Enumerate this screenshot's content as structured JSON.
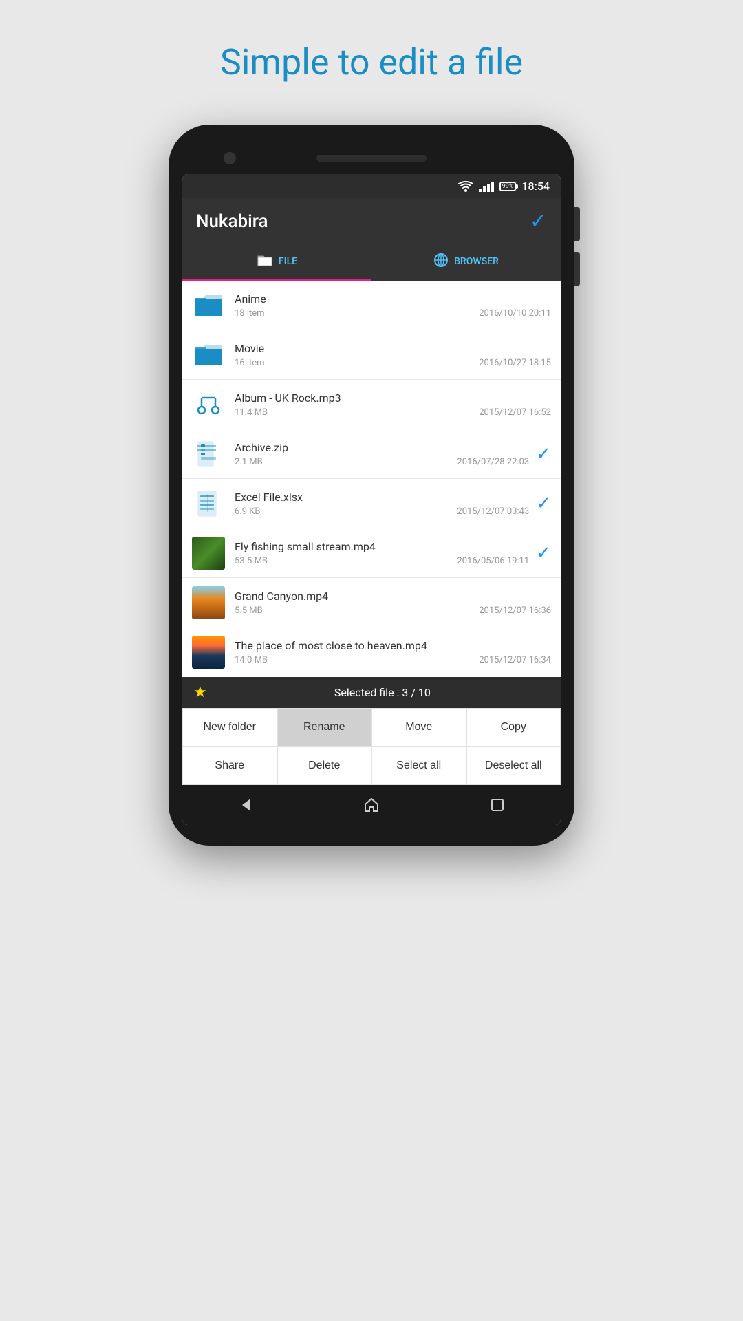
{
  "page": {
    "headline": "Simple to edit a file"
  },
  "statusBar": {
    "battery": "99%",
    "time": "18:54"
  },
  "appBar": {
    "title": "Nukabira"
  },
  "tabs": [
    {
      "id": "file",
      "label": "FILE",
      "active": true
    },
    {
      "id": "browser",
      "label": "BROWSER",
      "active": false
    }
  ],
  "files": [
    {
      "id": 1,
      "name": "Anime",
      "type": "folder",
      "count": "18 item",
      "date": "2016/10/10 20:11",
      "selected": false
    },
    {
      "id": 2,
      "name": "Movie",
      "type": "folder",
      "count": "16 item",
      "date": "2016/10/27 18:15",
      "selected": false
    },
    {
      "id": 3,
      "name": "Album - UK Rock.mp3",
      "type": "audio",
      "size": "11.4 MB",
      "date": "2015/12/07 16:52",
      "selected": false
    },
    {
      "id": 4,
      "name": "Archive.zip",
      "type": "zip",
      "size": "2.1 MB",
      "date": "2016/07/28 22:03",
      "selected": true
    },
    {
      "id": 5,
      "name": "Excel File.xlsx",
      "type": "excel",
      "size": "6.9 KB",
      "date": "2015/12/07 03:43",
      "selected": true
    },
    {
      "id": 6,
      "name": "Fly fishing small stream.mp4",
      "type": "video-fishing",
      "size": "53.5 MB",
      "date": "2016/05/06 19:11",
      "selected": true
    },
    {
      "id": 7,
      "name": "Grand Canyon.mp4",
      "type": "video-canyon",
      "size": "5.5 MB",
      "date": "2015/12/07 16:36",
      "selected": false
    },
    {
      "id": 8,
      "name": "The place of most close to heaven.mp4",
      "type": "video-heaven",
      "size": "14.0 MB",
      "date": "2015/12/07 16:34",
      "selected": false
    }
  ],
  "selectedBar": {
    "text": "Selected file : 3 / 10"
  },
  "actions": {
    "row1": [
      {
        "id": "new-folder",
        "label": "New folder",
        "highlighted": false
      },
      {
        "id": "rename",
        "label": "Rename",
        "highlighted": true
      },
      {
        "id": "move",
        "label": "Move",
        "highlighted": false
      },
      {
        "id": "copy",
        "label": "Copy",
        "highlighted": false
      }
    ],
    "row2": [
      {
        "id": "share",
        "label": "Share",
        "highlighted": false
      },
      {
        "id": "delete",
        "label": "Delete",
        "highlighted": false
      },
      {
        "id": "select-all",
        "label": "Select all",
        "highlighted": false
      },
      {
        "id": "deselect-all",
        "label": "Deselect all",
        "highlighted": false
      }
    ]
  }
}
